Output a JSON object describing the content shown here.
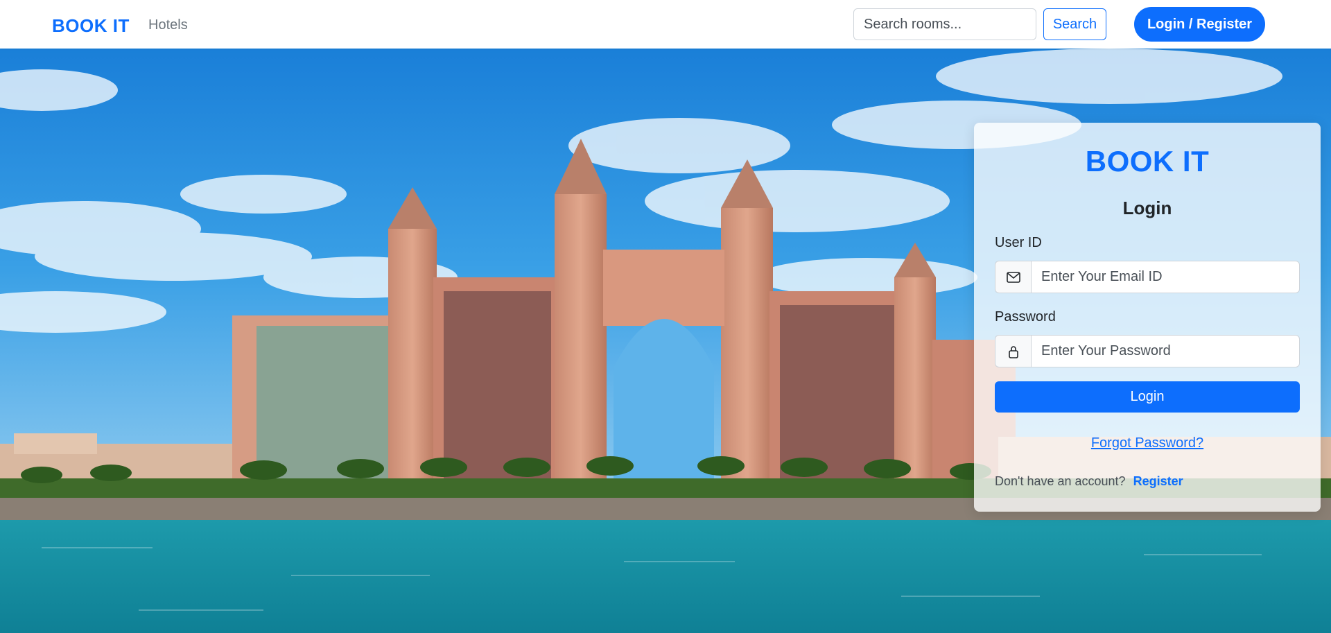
{
  "navbar": {
    "brand": "BOOK IT",
    "links": [
      "Hotels"
    ],
    "search_placeholder": "Search rooms...",
    "search_button": "Search",
    "auth_button": "Login / Register"
  },
  "login_card": {
    "brand": "BOOK IT",
    "heading": "Login",
    "user_id_label": "User ID",
    "user_id_placeholder": "Enter Your Email ID",
    "password_label": "Password",
    "password_placeholder": "Enter Your Password",
    "submit_label": "Login",
    "forgot_link": "Forgot Password?",
    "no_account_text": "Don't have an account?",
    "register_link": "Register"
  },
  "icons": {
    "email": "envelope-icon",
    "password": "lock-icon"
  },
  "colors": {
    "accent": "#0d6efd",
    "card_background": "rgba(255,255,255,0.78)"
  }
}
